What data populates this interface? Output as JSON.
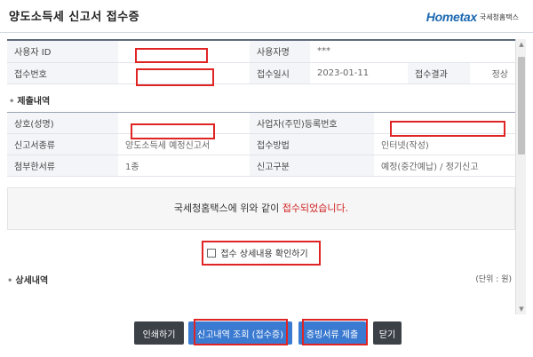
{
  "header": {
    "title": "양도소득세 신고서 접수증",
    "logo_brand": "Hometax",
    "logo_sub": "국세청홈택스"
  },
  "info_rows": [
    {
      "label1": "사용자 ID",
      "value1": "",
      "label2": "사용자명",
      "value2": "***"
    },
    {
      "label1": "접수번호",
      "value1": "",
      "label2": "접수일시",
      "value2": "2023-01-11",
      "label3": "접수결과",
      "value3": "정상"
    }
  ],
  "submission": {
    "section_title": "제출내역",
    "rows": [
      {
        "label1": "상호(성명)",
        "value1": "",
        "label2": "사업자(주민)등록번호",
        "value2": ""
      },
      {
        "label1": "신고서종류",
        "value1": "양도소득세 예정신고서",
        "label2": "접수방법",
        "value2": "인터넷(작성)"
      },
      {
        "label1": "첨부한서류",
        "value1": "1종",
        "label2": "신고구분",
        "value2": "예정(중간예납) / 정기신고"
      }
    ]
  },
  "notice": {
    "prefix": "국세청홈택스에 위와 같이 ",
    "highlight": "접수되었습니다."
  },
  "checkbox": {
    "label": "접수 상세내용 확인하기",
    "checked": false
  },
  "details": {
    "section_title": "상세내역",
    "unit": "(단위 : 원)"
  },
  "buttons": {
    "print": "인쇄하기",
    "lookup": "신고내역 조회 (접수증)",
    "submit_docs": "증빙서류 제출",
    "close": "닫기"
  },
  "colors": {
    "accent_blue": "#3a7ad1",
    "dark_button": "#3c4148",
    "highlight_red": "#d01f1f",
    "annotation_red": "#e02424"
  }
}
